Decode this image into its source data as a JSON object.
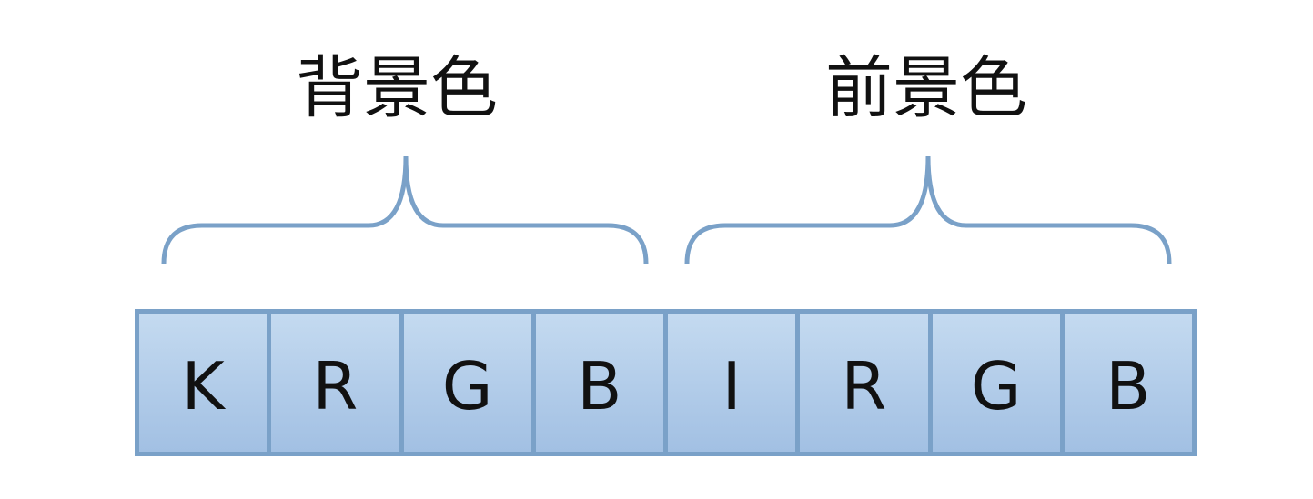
{
  "groups": [
    {
      "label": "背景色"
    },
    {
      "label": "前景色"
    }
  ],
  "bits": [
    "K",
    "R",
    "G",
    "B",
    "I",
    "R",
    "G",
    "B"
  ],
  "colors": {
    "brace": "#7aa1c8",
    "cell_border": "#7aa1c8",
    "cell_fill_top": "#c4daf0",
    "cell_fill_bottom": "#a2c0e3",
    "text": "#111111"
  }
}
